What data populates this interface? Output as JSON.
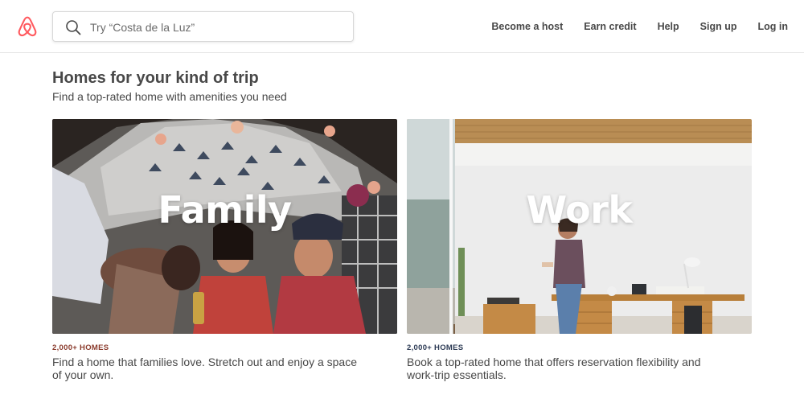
{
  "brand": {
    "logo_icon": "airbnb-belo-icon",
    "color": "#FF5A5F"
  },
  "search": {
    "placeholder": "Try “Costa de la Luz”",
    "icon": "search-icon"
  },
  "nav": {
    "items": [
      {
        "label": "Become a host"
      },
      {
        "label": "Earn credit"
      },
      {
        "label": "Help"
      },
      {
        "label": "Sign up"
      },
      {
        "label": "Log in"
      }
    ]
  },
  "section": {
    "title": "Homes for your kind of trip",
    "subtitle": "Find a top-rated home with amenities you need"
  },
  "cards": [
    {
      "word": "Family",
      "eyebrow": "2,000+ HOMES",
      "eyebrow_color": "#8A3A2B",
      "description": "Find a home that families love. Stretch out and enjoy a space of your own."
    },
    {
      "word": "Work",
      "eyebrow": "2,000+ HOMES",
      "eyebrow_color": "#2D3B55",
      "description": "Book a top-rated home that offers reservation flexibility and work-trip essentials."
    }
  ]
}
